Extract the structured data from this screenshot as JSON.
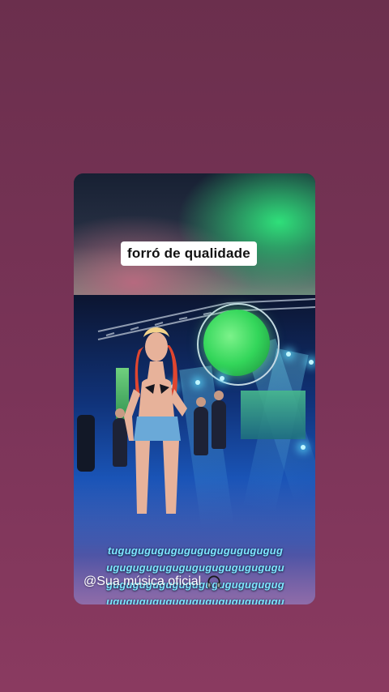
{
  "story": {
    "caption": "forró de qualidade",
    "lyrics": "tugugugugugugugugugugugugugugugugugugugugugugugugugugugugugugugugugugugugugugugugugugugugugugugugugugugugugugugugugugugugugugugugugugugugugugugugugugugugugugugugugugugugugugugugugugugugugu,",
    "credit": "@Sua música oficial",
    "icons": {
      "credit_icon": "headphones-icon"
    }
  }
}
